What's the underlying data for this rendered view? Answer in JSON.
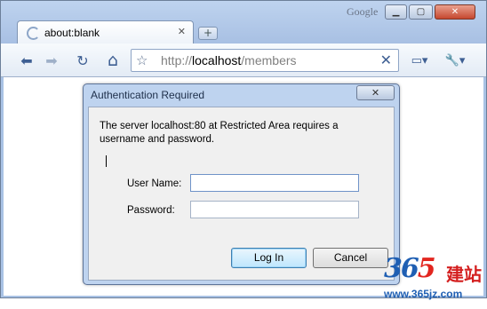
{
  "window": {
    "brand": "Google",
    "controls": {
      "minimize": "▁",
      "maximize": "▢",
      "close": "✕"
    }
  },
  "tab": {
    "title": "about:blank",
    "close": "✕",
    "new_tab": "+"
  },
  "toolbar": {
    "back": "⬅",
    "forward": "➡",
    "reload": "↻",
    "home": "⌂",
    "star": "☆",
    "stop": "✕",
    "page": "▭▾",
    "wrench": "🔧▾",
    "url_scheme": "http://",
    "url_host": "localhost",
    "url_path": "/members"
  },
  "dialog": {
    "title": "Authentication Required",
    "close": "✕",
    "message": "The server localhost:80 at Restricted Area requires a username and password.",
    "username_label": "User Name:",
    "username_value": "",
    "password_label": "Password:",
    "password_value": "",
    "login_label": "Log In",
    "cancel_label": "Cancel"
  },
  "watermark": {
    "num_a": "36",
    "num_b": "5",
    "cn": "建站",
    "url": "www.365jz.com"
  },
  "colors": {
    "chrome_frame": "#a9c2e4",
    "dialog_frame": "#bed3ef",
    "link_blue": "#3e5f93",
    "watermark_red": "#e2261f",
    "watermark_blue": "#1f5fb3"
  }
}
